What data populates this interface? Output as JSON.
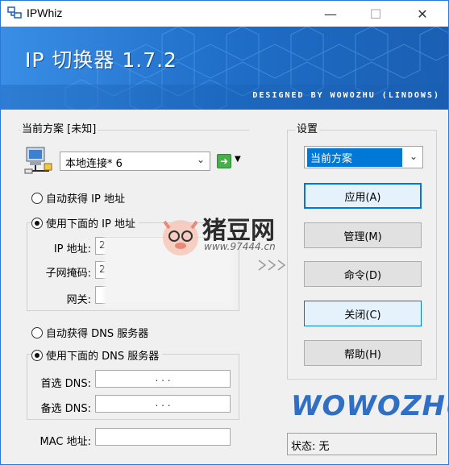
{
  "window": {
    "title": "IPWhiz",
    "minimize": "—",
    "maximize": "☐",
    "close": "✕"
  },
  "banner": {
    "title": "IP 切换器 1.7.2",
    "credit": "DESIGNED BY WOWOZHU (LINDOWS)"
  },
  "profile": {
    "group_label": "当前方案 [未知]",
    "adapter": "本地连接* 6",
    "ip_group": {
      "auto_label": "自动获得 IP 地址",
      "manual_label": "使用下面的 IP 地址",
      "auto_selected": false,
      "ip_label": "IP 地址:",
      "ip_value": "2",
      "mask_label": "子网掩码:",
      "mask_value": "2",
      "gateway_label": "网关:",
      "gateway_value": ""
    },
    "dns_group": {
      "auto_label": "自动获得 DNS 服务器",
      "manual_label": "使用下面的 DNS 服务器",
      "preferred_label": "首选 DNS:",
      "alternate_label": "备选 DNS:",
      "dots": ".          .          ."
    },
    "mac_label": "MAC 地址:",
    "mac_value": ""
  },
  "settings": {
    "group_label": "设置",
    "scheme_selected": "当前方案",
    "buttons": {
      "apply": "应用(A)",
      "manage": "管理(M)",
      "command": "命令(D)",
      "close": "关闭(C)",
      "help": "帮助(H)"
    }
  },
  "logo": "WOWOZHU",
  "status": "状态: 无",
  "watermark": {
    "text": "猪豆网",
    "url": "www.97444.cn"
  },
  "colors": {
    "banner": "#1f7ad6",
    "accent": "#0078d7",
    "logo": "#2f6fc4"
  }
}
